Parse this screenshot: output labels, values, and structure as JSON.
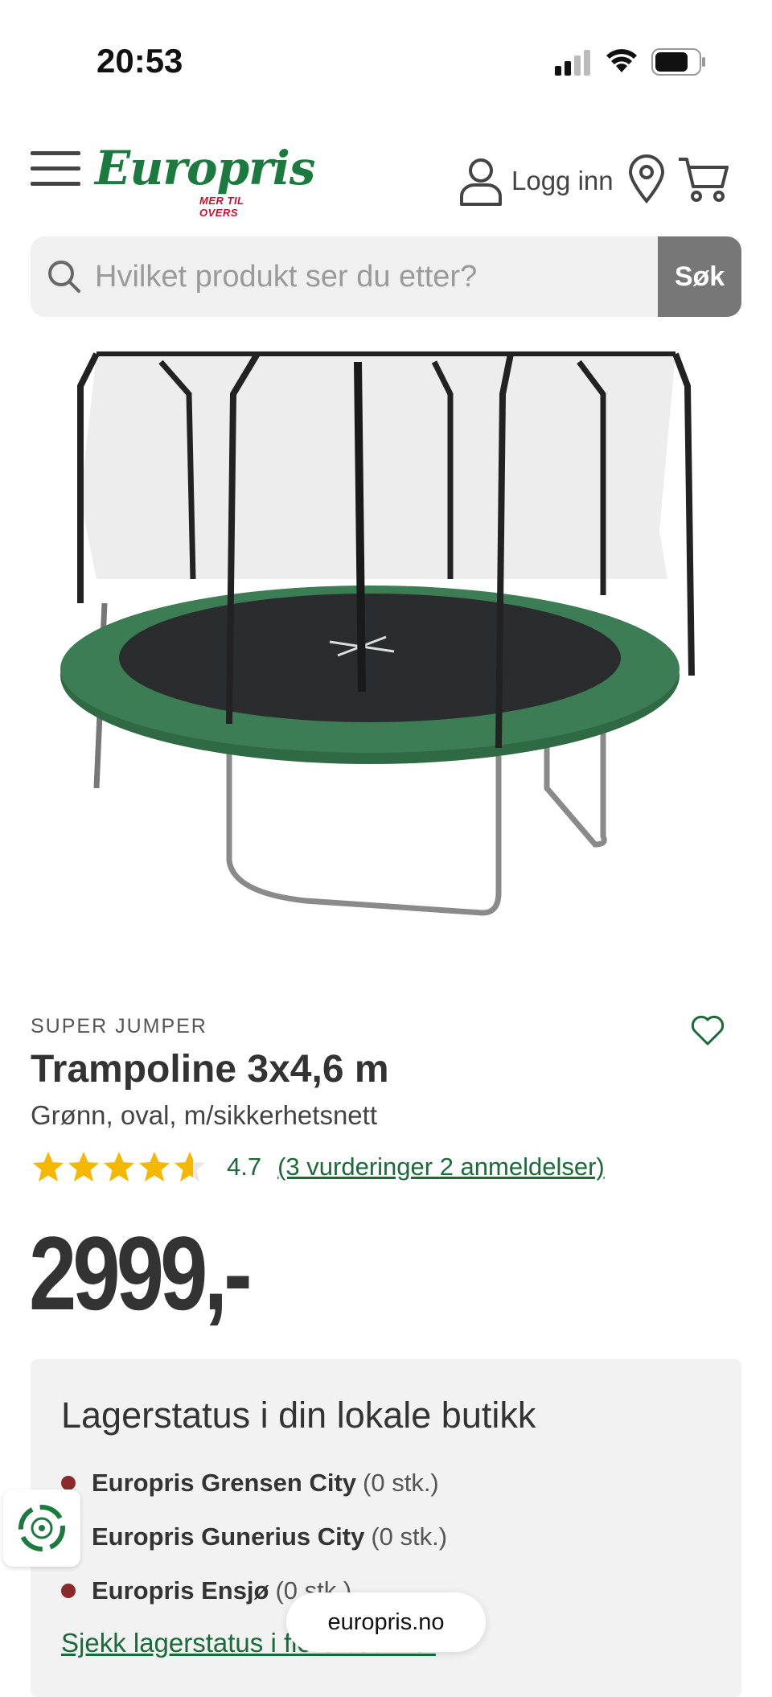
{
  "status_bar": {
    "time": "20:53"
  },
  "header": {
    "logo_text": "Europris",
    "logo_tagline": "MER TIL OVERS",
    "login_label": "Logg inn"
  },
  "search": {
    "placeholder": "Hvilket produkt ser du etter?",
    "button_label": "Søk"
  },
  "product": {
    "brand": "SUPER JUMPER",
    "title": "Trampoline 3x4,6 m",
    "subtitle": "Grønn, oval, m/sikkerhetsnett",
    "rating_value": "4.7",
    "rating_link": "(3 vurderinger 2 anmeldelser)",
    "price": "2999,-",
    "colors": {
      "brand_green": "#1b7a3e",
      "star": "#f5b800",
      "tag_red": "#c8102e"
    }
  },
  "stock": {
    "title": "Lagerstatus i din lokale butikk",
    "stores": [
      {
        "name": "Europris Grensen City",
        "qty": "(0 stk.)"
      },
      {
        "name": "Europris Gunerius City",
        "qty": "(0 stk.)"
      },
      {
        "name": "Europris Ensjø",
        "qty": "(0 stk.)"
      }
    ],
    "link": "Sjekk lagerstatus i flere butikker"
  },
  "browser": {
    "url": "europris.no"
  }
}
